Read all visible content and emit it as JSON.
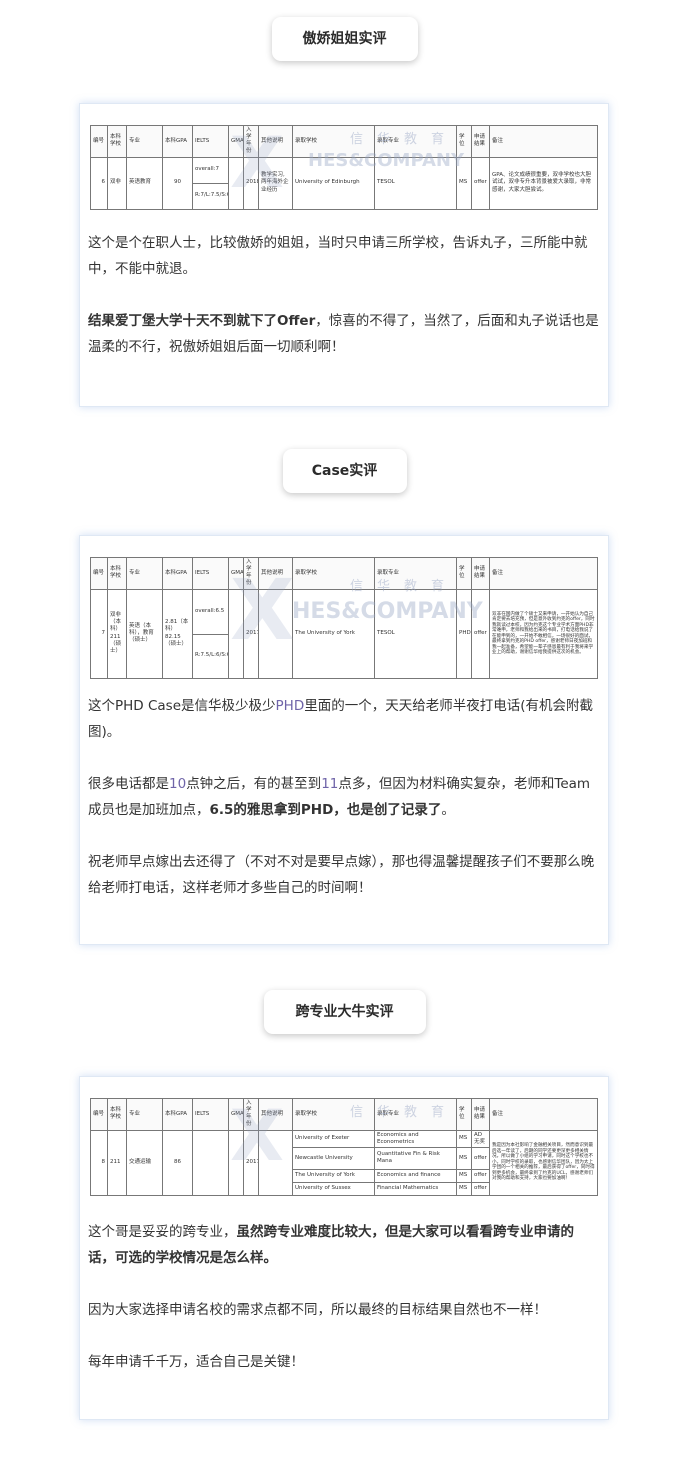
{
  "sections": [
    {
      "title": "傲娇姐姐实评",
      "table": {
        "headers": [
          "编号",
          "本科学校",
          "专业",
          "本科GPA",
          "IELTS",
          "GMAT/GRE",
          "入学年份",
          "其他说明",
          "录取学校",
          "录取专业",
          "学位",
          "申请结果",
          "备注"
        ],
        "row": {
          "no": "6",
          "school": "双非",
          "major": "英语教育",
          "gpa": "90",
          "ielts1": "overall:7",
          "ielts2": "R:7/L:7.5/S:6.5",
          "gmat": "",
          "year": "2018",
          "note": "教学实习,两年海外企业经历",
          "univ": "University of Edinburgh",
          "program": "TESOL",
          "degree": "MS",
          "result": "offer",
          "remark": "GPA、论文成绩很重要，双非学校也大胆试试，双非专升本背景被爱大录取，非常感谢，大家大胆尝试。"
        }
      },
      "paragraphs": [
        "这个是个在职人士，比较傲娇的姐姐，当时只申请三所学校，告诉丸子，三所能中就中，不能中就退。"
      ],
      "p2_bold": "结果爱丁堡大学十天不到就下了Offer",
      "p2_rest": "，惊喜的不得了，当然了，后面和丸子说话也是温柔的不行，祝傲娇姐姐后面一切顺利啊！"
    },
    {
      "title": "Case实评",
      "table": {
        "headers": [
          "编号",
          "本科学校",
          "专业",
          "本科GPA",
          "IELTS",
          "GMAT/GRE",
          "入学年份",
          "其他说明",
          "录取学校",
          "录取专业",
          "学位",
          "申请结果",
          "备注"
        ],
        "row": {
          "no": "7",
          "school": "双非（本科）211（硕士）",
          "major": "英语（本科），教育（硕士）",
          "gpa": "2.81（本科）82.15（硕士）",
          "ielts1": "overall:6.5",
          "ielts2": "R:7.5/L:6/S:6/W:6.5",
          "gmat": "",
          "year": "2017",
          "note": "",
          "univ": "The University of York",
          "program": "TESOL",
          "degree": "PHD",
          "result": "offer",
          "remark": "双非在国内做了个硕士又来申请，一开始认为自己肯定要去培充预，但是意外收到约克的offer，同时我就读过本校，因为约克这个专业学术方面PHD非常难申，老师和我给出来的书目，打电话给我说了在能申到的，一开始不敢相信，一场很好的面试，最终拿到约克的PHD offer，感谢老师日夜加班和我一起准备，希望能一辈子感恩最有利于我将来学业上的帮助，谢谢信华给我提供这次的机会。"
        }
      },
      "p1_a": "这个PHD Case是信华极少极少",
      "p1_hl": "PHD",
      "p1_b": "里面的一个，天天给老师半夜打电话(有机会附截图)。",
      "p2_a": "很多电话都是",
      "p2_n1": "10",
      "p2_b": "点钟之后，有的甚至到",
      "p2_n2": "11",
      "p2_c": "点多，但因为材料确实复杂，老师和Team成员也是加班加点，",
      "p2_bold": "6.5的雅思拿到PHD，也是创了记录了",
      "p2_d": "。",
      "p3": "祝老师早点嫁出去还得了（不对不对是要早点嫁），那也得温馨提醒孩子们不要那么晚给老师打电话，这样老师才多些自己的时间啊！"
    },
    {
      "title": "跨专业大牛实评",
      "table": {
        "headers": [
          "编号",
          "本科学校",
          "专业",
          "本科GPA",
          "IELTS",
          "GMAT/GRE",
          "入学年份",
          "其他说明",
          "录取学校",
          "录取专业",
          "学位",
          "申请结果",
          "备注"
        ],
        "row": {
          "no": "8",
          "school": "211",
          "major": "交通运输",
          "gpa": "86",
          "gmat": "",
          "year": "2017",
          "note": "",
          "remark": "我是因为本社影响了金融相关项目，然而意识到最后选一年读了，后期的同学还要更深更多相关情况，所以做了小组的学习申请，同时这个学校也不小，同时学校的录取，也感谢信华团队，因为太上学团的一个相关的推荐，最后获得了offer，同时得到更多机会，最终拿到了约克的UCL，感谢老师们对我的帮助和支持，大家也要加油啊！"
        },
        "offers": [
          {
            "univ": "University of Exeter",
            "program": "Economics and Econometrics",
            "degree": "MS",
            "result": "AD无奖"
          },
          {
            "univ": "Newcastle University",
            "program": "Quantitative Fin & Risk Mana",
            "degree": "MS",
            "result": "offer"
          },
          {
            "univ": "The University of York",
            "program": "Economics and finance",
            "degree": "MS",
            "result": "offer"
          },
          {
            "univ": "University of Sussex",
            "program": "Financial Mathematics",
            "degree": "MS",
            "result": "offer"
          }
        ]
      },
      "p1_a": "这个哥是妥妥的跨专业，",
      "p1_bold": "虽然跨专业难度比较大，但是大家可以看看跨专业申请的话，可选的学校情况是怎么样。",
      "p2": "因为大家选择申请名校的需求点都不同，所以最终的目标结果自然也不一样！",
      "p3": "每年申请千千万，适合自己是关键！"
    }
  ],
  "watermark": {
    "cn": "信华教育",
    "en": "HES&COMPANY"
  },
  "colors": {
    "highlight": "#6f64a8",
    "card_border": "#dfe8f4"
  }
}
